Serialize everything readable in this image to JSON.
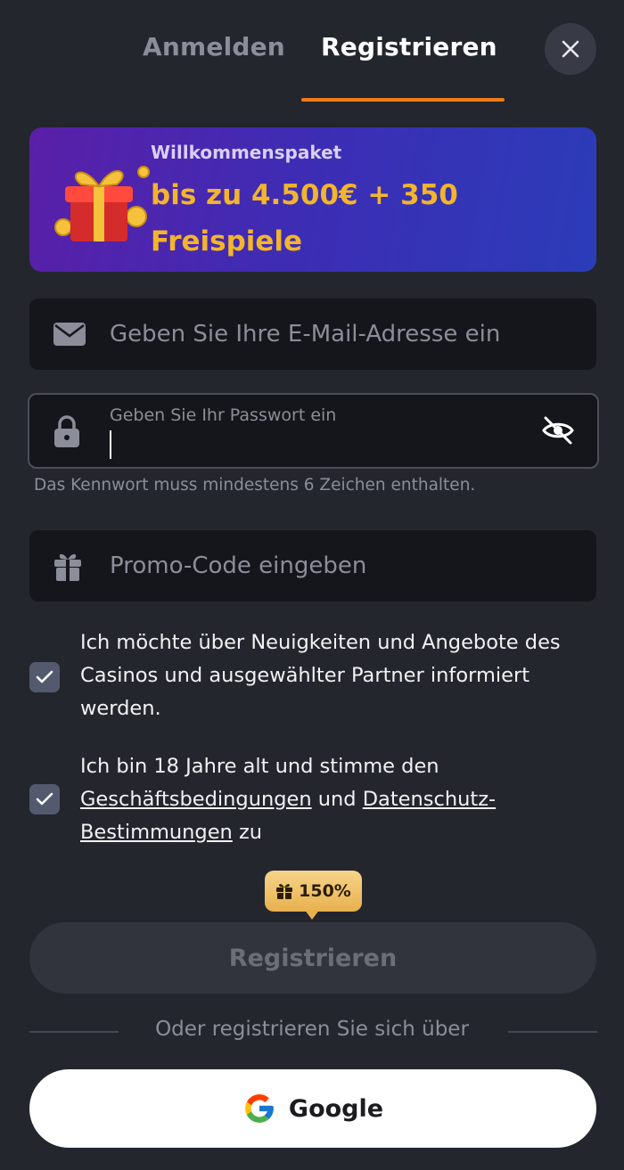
{
  "tabs": {
    "login": "Anmelden",
    "register": "Registrieren"
  },
  "banner": {
    "label": "Willkommenspaket",
    "amount": "bis zu 4.500€ + 350 Freispiele"
  },
  "form": {
    "email_placeholder": "Geben Sie Ihre E-Mail-Adresse ein",
    "password_label": "Geben Sie Ihr Passwort ein",
    "password_value": "",
    "password_hint": "Das Kennwort muss mindestens 6 Zeichen enthalten.",
    "promo_placeholder": "Promo-Code eingeben"
  },
  "consents": {
    "newsletter": "Ich möchte über Neuigkeiten und Angebote des Casinos und ausgewählter Partner informiert werden.",
    "age_prefix": "Ich bin 18 Jahre alt und stimme den ",
    "terms_link": "Geschäftsbedingungen",
    "and": " und ",
    "privacy_link": "Datenschutz-Bestimmungen",
    "age_suffix": " zu"
  },
  "bonus_badge": "150%",
  "register_button": "Registrieren",
  "divider_text": "Oder registrieren Sie sich über",
  "google_button": "Google",
  "colors": {
    "accent": "#f07b1c",
    "gold": "#f3b52a",
    "background": "#24262e"
  }
}
